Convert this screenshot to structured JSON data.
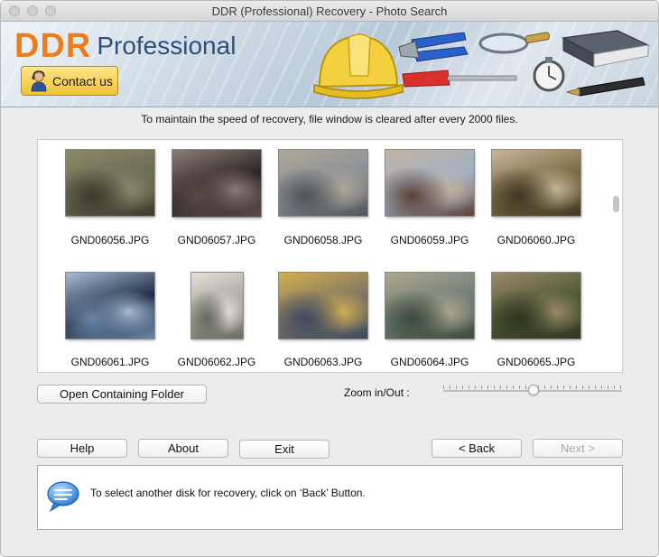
{
  "window": {
    "title": "DDR (Professional) Recovery - Photo Search"
  },
  "banner": {
    "brand": "DDR",
    "edition": "Professional",
    "contact_label": "Contact us",
    "tool_icons": [
      "hard-hat-icon",
      "pliers-icon",
      "screwdriver-icon",
      "magnifier-icon",
      "stopwatch-icon",
      "book-icon",
      "pen-icon"
    ]
  },
  "info_text": "To maintain the speed of recovery, file window is cleared after every 2000 files.",
  "files": [
    {
      "name": "GND06056.JPG",
      "palette": [
        "#6d6b52",
        "#3c3b2d",
        "#8b8a6a"
      ]
    },
    {
      "name": "GND06057.JPG",
      "palette": [
        "#2b2526",
        "#5a4a47",
        "#8c7d77"
      ]
    },
    {
      "name": "GND06058.JPG",
      "palette": [
        "#8a9098",
        "#505458",
        "#b0a898"
      ]
    },
    {
      "name": "GND06059.JPG",
      "palette": [
        "#9fb0c2",
        "#5c4038",
        "#c4b4a4"
      ]
    },
    {
      "name": "GND06060.JPG",
      "palette": [
        "#7a6a42",
        "#3f3a26",
        "#c7b79a"
      ]
    },
    {
      "name": "GND06061.JPG",
      "palette": [
        "#1f2d44",
        "#6b86a6",
        "#a7bdd4"
      ]
    },
    {
      "name": "GND06062.JPG",
      "palette": [
        "#a7a69c",
        "#6b6a60",
        "#e2e0d8"
      ]
    },
    {
      "name": "GND06063.JPG",
      "palette": [
        "#7e7366",
        "#3e4a5e",
        "#d4b050"
      ]
    },
    {
      "name": "GND06064.JPG",
      "palette": [
        "#6f7e78",
        "#3c4a3a",
        "#b0a890"
      ]
    },
    {
      "name": "GND06065.JPG",
      "palette": [
        "#4e5a32",
        "#2f3620",
        "#9c8a6a"
      ]
    }
  ],
  "open_folder_label": "Open Containing Folder",
  "zoom": {
    "label": "Zoom in/Out :",
    "level": 0.5
  },
  "buttons": {
    "help": "Help",
    "about": "About",
    "exit": "Exit",
    "back": "< Back",
    "next": "Next >"
  },
  "message": {
    "icon": "speech-bubble-icon",
    "text": "To select another disk for recovery, click on ‘Back’ Button."
  }
}
